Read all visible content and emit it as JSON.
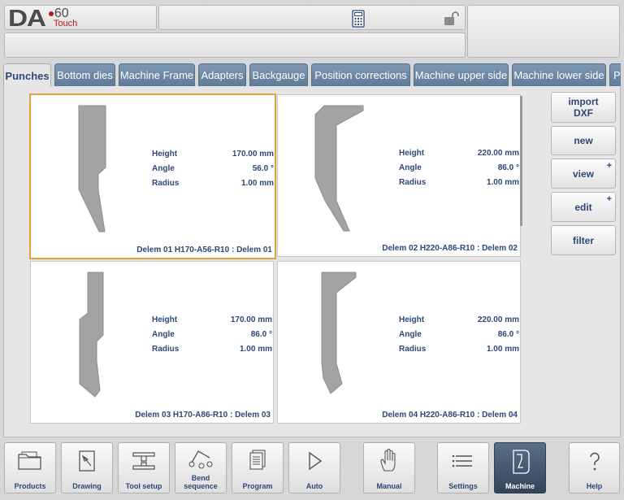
{
  "logo": {
    "brand": "DA",
    "model": "60",
    "sub": "Touch"
  },
  "tabs": [
    {
      "label": "Punches",
      "active": true
    },
    {
      "label": "Bottom dies"
    },
    {
      "label": "Machine Frame"
    },
    {
      "label": "Adapters"
    },
    {
      "label": "Backgauge"
    },
    {
      "label": "Position corrections"
    },
    {
      "label": "Machine upper side"
    },
    {
      "label": "Machine lower side"
    },
    {
      "label": "P"
    }
  ],
  "labels": {
    "height": "Height",
    "angle": "Angle",
    "radius": "Radius"
  },
  "tools": [
    {
      "name": "Delem 01 H170-A56-R10 : Delem 01",
      "height": "170.00 mm",
      "angle": "56.0 °",
      "radius": "1.00 mm",
      "selected": true
    },
    {
      "name": "Delem 02 H220-A86-R10 : Delem 02",
      "height": "220.00 mm",
      "angle": "86.0 °",
      "radius": "1.00 mm"
    },
    {
      "name": "Delem 03 H170-A86-R10 : Delem 03",
      "height": "170.00 mm",
      "angle": "86.0 °",
      "radius": "1.00 mm"
    },
    {
      "name": "Delem 04 H220-A86-R10 : Delem 04",
      "height": "220.00 mm",
      "angle": "86.0 °",
      "radius": "1.00 mm"
    }
  ],
  "side_buttons": {
    "import_line1": "import",
    "import_line2": "DXF",
    "new": "new",
    "view": "view",
    "edit": "edit",
    "filter": "filter",
    "plus": "+"
  },
  "bottom_bar": [
    {
      "label": "Products",
      "icon": "folder-icon"
    },
    {
      "label": "Drawing",
      "icon": "drawing-icon"
    },
    {
      "label": "Tool setup",
      "icon": "tool-setup-icon"
    },
    {
      "label": "Bend sequence",
      "icon": "bend-sequence-icon"
    },
    {
      "label": "Program",
      "icon": "program-icon"
    },
    {
      "label": "Auto",
      "icon": "play-icon"
    },
    {
      "label": "Manual",
      "icon": "hand-icon"
    },
    {
      "label": "Settings",
      "icon": "settings-icon"
    },
    {
      "label": "Machine",
      "icon": "machine-icon",
      "active": true
    },
    {
      "label": "Help",
      "icon": "help-icon"
    }
  ],
  "colors": {
    "accent": "#2d4876",
    "tab": "#6b86a4",
    "selected_border": "#e2a23b",
    "logo_red": "#c0141b"
  }
}
